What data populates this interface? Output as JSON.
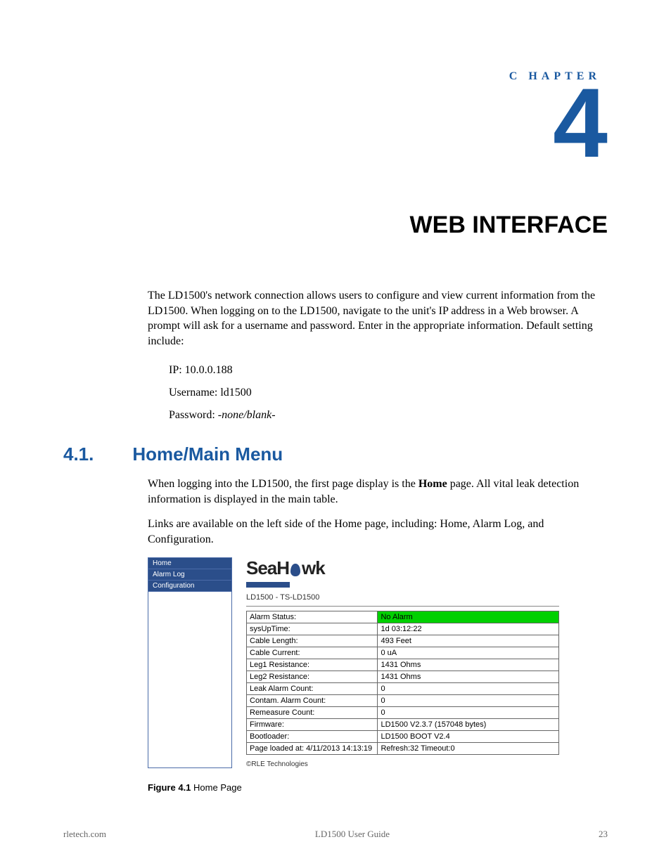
{
  "chapter": {
    "label": "C HAPTER",
    "number": "4",
    "title": "WEB INTERFACE"
  },
  "intro": "The LD1500's network connection allows users to configure and view current information from the LD1500. When logging on to the LD1500, navigate to the unit's IP address in a Web browser. A prompt will ask for a username and password. Enter in the appropriate information. Default setting include:",
  "defaults": {
    "ip_label": "IP: ",
    "ip": "10.0.0.188",
    "user_label": "Username: ",
    "user": "ld1500",
    "pass_label": "Password: ",
    "pass": "-none/blank-"
  },
  "section": {
    "num": "4.1.",
    "title": "Home/Main Menu",
    "p1a": "When logging into the LD1500, the first page display is the ",
    "p1b": "Home",
    "p1c": " page. All vital leak detection information is displayed in the main table.",
    "p2": "Links are available on the left side of the Home page, including: Home, Alarm Log, and Configuration."
  },
  "screenshot": {
    "nav": [
      "Home",
      "Alarm Log",
      "Configuration"
    ],
    "logo_a": "SeaH",
    "logo_b": "wk",
    "device": "LD1500 -  TS-LD1500",
    "rows": [
      {
        "label": "Alarm Status:",
        "value": "No Alarm",
        "class": "noalarm"
      },
      {
        "label": "sysUpTime:",
        "value": "1d 03:12:22"
      },
      {
        "label": "Cable Length:",
        "value": "493 Feet"
      },
      {
        "label": "Cable Current:",
        "value": "0 uA"
      },
      {
        "label": "Leg1 Resistance:",
        "value": "1431 Ohms"
      },
      {
        "label": "Leg2 Resistance:",
        "value": "1431 Ohms"
      },
      {
        "label": "Leak Alarm Count:",
        "value": "0"
      },
      {
        "label": "Contam. Alarm Count:",
        "value": "0"
      },
      {
        "label": "Remeasure Count:",
        "value": "0"
      },
      {
        "label": "Firmware:",
        "value": "LD1500 V2.3.7 (157048 bytes)"
      },
      {
        "label": "Bootloader:",
        "value": "LD1500 BOOT V2.4"
      },
      {
        "label": "Page loaded at: 4/11/2013 14:13:19",
        "value": "Refresh:32 Timeout:0"
      }
    ],
    "copyright": "©RLE Technologies"
  },
  "figure_caption": {
    "label": "Figure 4.1",
    "text": "  Home Page"
  },
  "footer": {
    "left": "rletech.com",
    "center": "LD1500 User Guide",
    "right": "23"
  }
}
